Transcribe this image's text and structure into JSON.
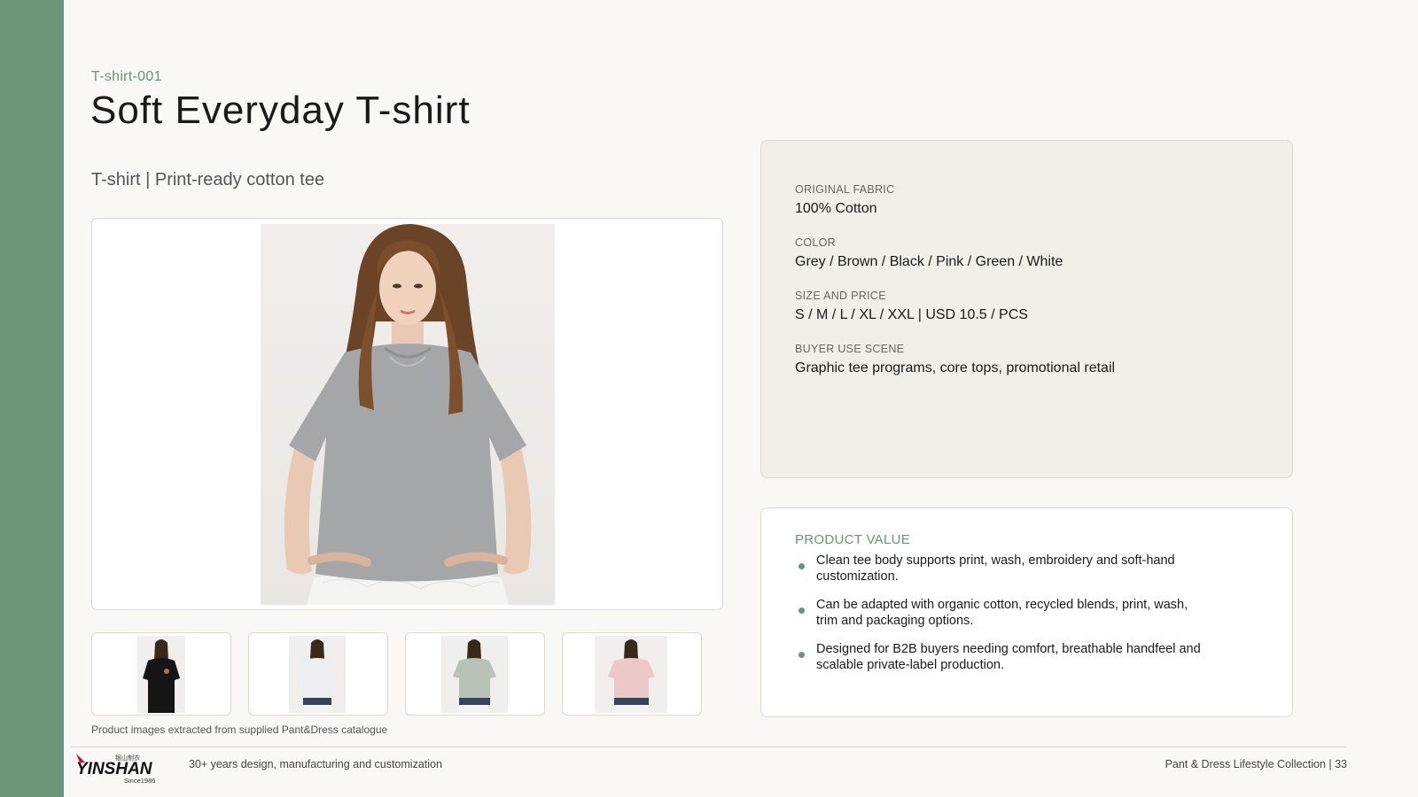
{
  "header": {
    "sku": "T-shirt-001",
    "title": "Soft Everyday T-shirt",
    "subtitle": "T-shirt | Print-ready cotton tee"
  },
  "gallery": {
    "main_image": "woman-grey-tshirt-photo",
    "thumbnails": [
      {
        "name": "black-tshirt-thumbnail",
        "color": "#151515"
      },
      {
        "name": "white-tshirt-thumbnail",
        "color": "#eceef0"
      },
      {
        "name": "sage-tshirt-thumbnail",
        "color": "#b9c2b7"
      },
      {
        "name": "pink-tshirt-thumbnail",
        "color": "#ecc8c9"
      }
    ],
    "caption": "Product images extracted from supplied Pant&Dress catalogue"
  },
  "specs": [
    {
      "label": "ORIGINAL FABRIC",
      "value": "100% Cotton"
    },
    {
      "label": "COLOR",
      "value": "Grey / Brown / Black / Pink / Green / White"
    },
    {
      "label": "SIZE AND PRICE",
      "value": "S / M / L / XL / XXL | USD 10.5 / PCS"
    },
    {
      "label": "BUYER USE SCENE",
      "value": "Graphic tee programs, core tops, promotional retail"
    }
  ],
  "product_value": {
    "heading": "PRODUCT VALUE",
    "bullets": [
      "Clean tee body supports print, wash, embroidery and soft-hand customization.",
      "Can be adapted with organic cotton, recycled blends, print, wash, trim and packaging options.",
      "Designed for B2B buyers needing comfort, breathable handfeel and scalable private-label production."
    ]
  },
  "footer": {
    "logo_text": "YINSHAN",
    "logo_chinese": "银山制衣",
    "logo_since": "Since1986",
    "tagline": "30+ years design, manufacturing and customization",
    "collection": "Pant & Dress Lifestyle Collection | 33"
  },
  "colors": {
    "accent": "#6b9478",
    "background": "#f9f8f4",
    "card": "#f2efe8",
    "logo_red": "#c8102e"
  }
}
